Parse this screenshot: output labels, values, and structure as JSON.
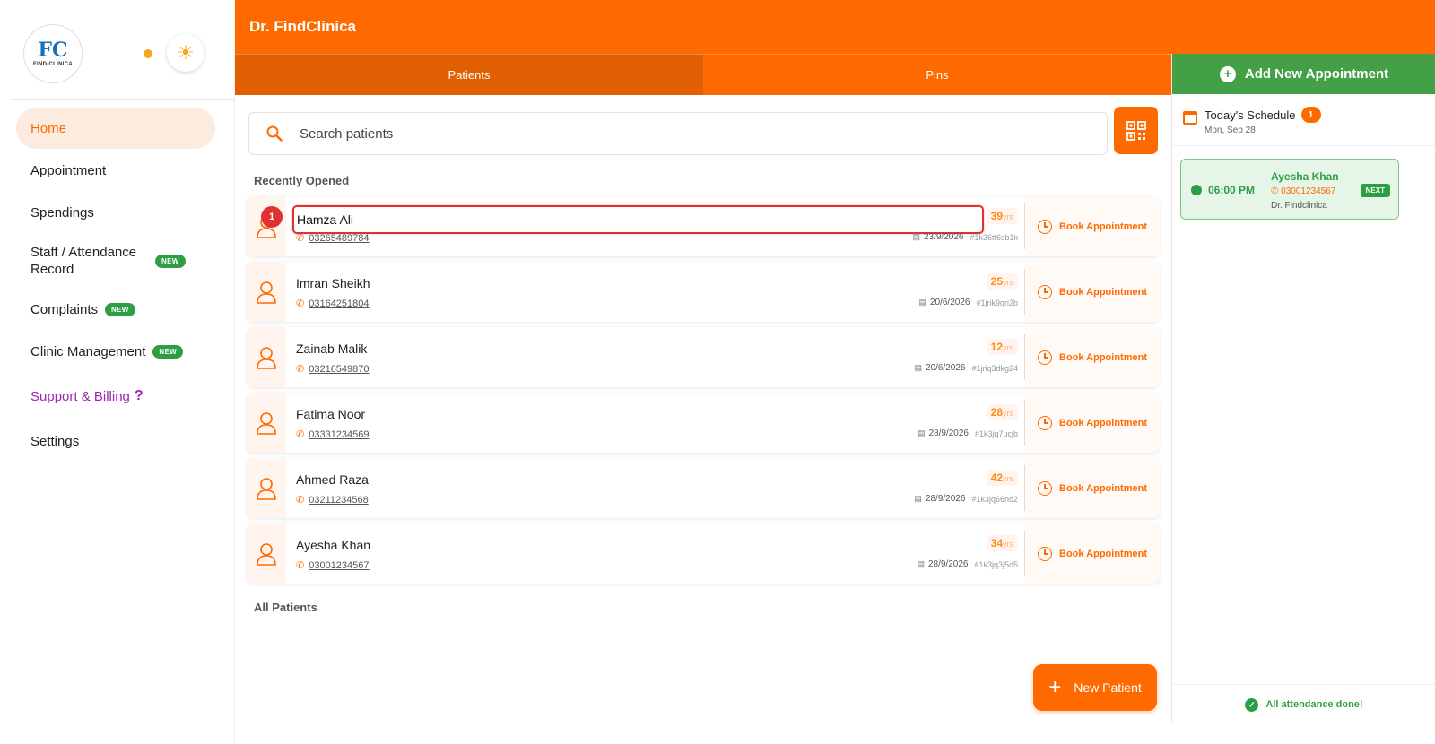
{
  "app": {
    "header_title": "Dr. FindClinica",
    "logo_letters": "FC",
    "logo_text": "FIND-CLINICA"
  },
  "sidebar": {
    "items": [
      {
        "label": "Home",
        "active": true,
        "badge": ""
      },
      {
        "label": "Appointment",
        "badge": ""
      },
      {
        "label": "Spendings",
        "badge": ""
      },
      {
        "label": "Staff / Attendance Record",
        "badge": "NEW"
      },
      {
        "label": "Complaints",
        "badge": "NEW"
      },
      {
        "label": "Clinic Management",
        "badge": "NEW"
      },
      {
        "label": "Support & Billing",
        "badge": "",
        "icon": "question-mark-icon"
      },
      {
        "label": "Settings",
        "badge": ""
      }
    ]
  },
  "tabs": [
    {
      "label": "Patients",
      "active": true
    },
    {
      "label": "Pins",
      "active": false
    }
  ],
  "search": {
    "placeholder": "Search patients"
  },
  "sections": {
    "recently_opened": "Recently Opened",
    "all_patients": "All Patients"
  },
  "patients": [
    {
      "name": "Hamza Ali",
      "phone": "03265489784",
      "age": "39",
      "age_unit": "yrs",
      "date": "23/9/2026",
      "id": "#1k36tf6sb1k"
    },
    {
      "name": "Imran Sheikh",
      "phone": "03164251804",
      "age": "25",
      "age_unit": "yrs",
      "date": "20/6/2026",
      "id": "#1jrik9gri2b"
    },
    {
      "name": "Zainab Malik",
      "phone": "03216549870",
      "age": "12",
      "age_unit": "yrs",
      "date": "20/6/2026",
      "id": "#1jriq3dkg24"
    },
    {
      "name": "Fatima Noor",
      "phone": "03331234569",
      "age": "28",
      "age_unit": "yrs",
      "date": "28/9/2026",
      "id": "#1k3jq7ucjb"
    },
    {
      "name": "Ahmed Raza",
      "phone": "03211234568",
      "age": "42",
      "age_unit": "yrs",
      "date": "28/9/2026",
      "id": "#1k3jq66nd2"
    },
    {
      "name": "Ayesha Khan",
      "phone": "03001234567",
      "age": "34",
      "age_unit": "yrs",
      "date": "28/9/2026",
      "id": "#1k3jq3j5d5"
    }
  ],
  "book_label": "Book Appointment",
  "highlight": {
    "marker": "1",
    "name": "Hamza Ali"
  },
  "new_patient_label": "New Patient",
  "right_panel": {
    "add_appointment_label": "Add New Appointment",
    "schedule_title": "Today's Schedule",
    "schedule_count": "1",
    "schedule_date": "Mon, Sep 28",
    "appointment": {
      "time": "06:00 PM",
      "name": "Ayesha Khan",
      "phone": "03001234567",
      "doctor": "Dr. Findclinica",
      "badge": "NEXT"
    },
    "attendance_text": "All attendance done!"
  },
  "colors": {
    "brand": "#ff6a00",
    "success": "#2e9e45",
    "support": "#9c27b0",
    "marker": "#e03131"
  }
}
